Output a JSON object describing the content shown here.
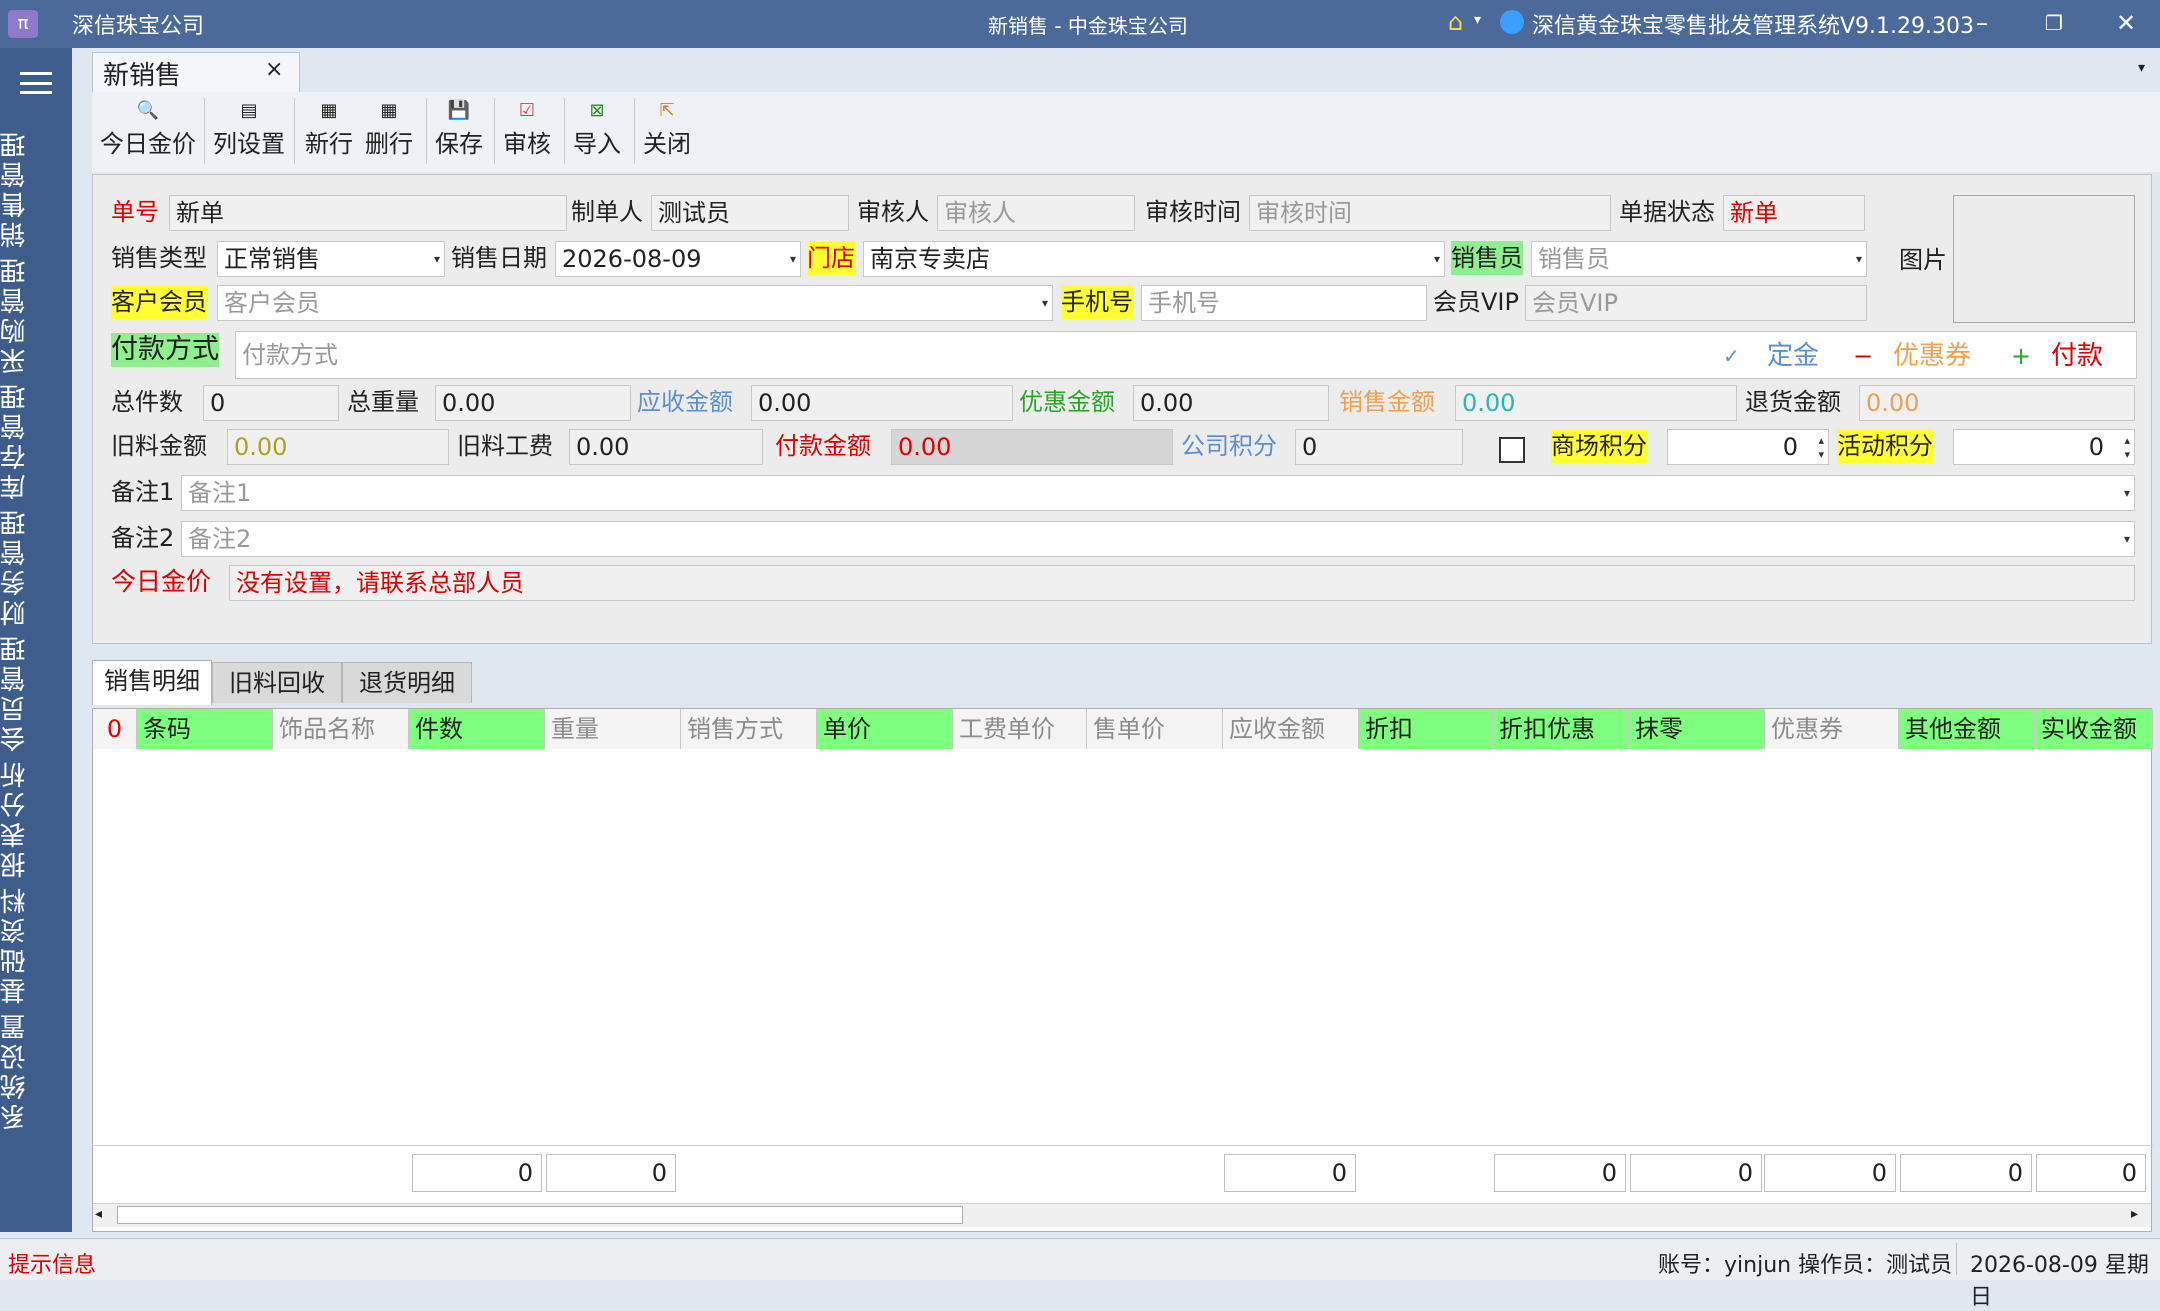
{
  "window": {
    "app_company": "深信珠宝公司",
    "doc_title": "新销售 - 中金珠宝公司",
    "system_title": "深信黄金珠宝零售批发管理系统V9.1.29.303"
  },
  "sidebar": {
    "items": [
      {
        "label": "销售管理"
      },
      {
        "label": "采购管理"
      },
      {
        "label": "库存管理"
      },
      {
        "label": "财务管理"
      },
      {
        "label": "会员管理"
      },
      {
        "label": "报表分析"
      },
      {
        "label": "基础资料"
      },
      {
        "label": "系统设置"
      }
    ]
  },
  "tabs": {
    "active": "新销售",
    "close": "×"
  },
  "toolbar": {
    "today_gold": "今日金价",
    "columns": "列设置",
    "new_row": "新行",
    "delete_row": "删行",
    "save": "保存",
    "audit": "审核",
    "import": "导入",
    "close": "关闭"
  },
  "form": {
    "doc_no_label": "单号",
    "doc_no": "新单",
    "maker_label": "制单人",
    "maker": "测试员",
    "auditor_label": "审核人",
    "auditor_ph": "审核人",
    "audit_time_label": "审核时间",
    "audit_time_ph": "审核时间",
    "status_label": "单据状态",
    "status": "新单",
    "image_label": "图片",
    "sale_type_label": "销售类型",
    "sale_type": "正常销售",
    "sale_date_label": "销售日期",
    "sale_date": "2026-08-09",
    "store_label": "门店",
    "store": "南京专卖店",
    "salesperson_label": "销售员",
    "salesperson_ph": "销售员",
    "customer_label": "客户会员",
    "customer_ph": "客户会员",
    "phone_label": "手机号",
    "phone_ph": "手机号",
    "vip_label": "会员VIP",
    "vip_ph": "会员VIP",
    "payment_label": "付款方式",
    "payment_ph": "付款方式",
    "deposit": "定金",
    "coupon": "优惠券",
    "pay": "付款",
    "total_pieces_label": "总件数",
    "total_pieces": "0",
    "total_weight_label": "总重量",
    "total_weight": "0.00",
    "receivable_label": "应收金额",
    "receivable": "0.00",
    "discount_label": "优惠金额",
    "discount": "0.00",
    "sales_amount_label": "销售金额",
    "sales_amount": "0.00",
    "return_amount_label": "退货金额",
    "return_amount": "0.00",
    "old_amount_label": "旧料金额",
    "old_amount": "0.00",
    "old_fee_label": "旧料工费",
    "old_fee": "0.00",
    "paid_label": "付款金额",
    "paid": "0.00",
    "company_points_label": "公司积分",
    "company_points": "0",
    "mall_points_label": "商场积分",
    "mall_points": "0",
    "event_points_label": "活动积分",
    "event_points": "0",
    "note1_label": "备注1",
    "note1_ph": "备注1",
    "note2_label": "备注2",
    "note2_ph": "备注2",
    "gold_price_label": "今日金价",
    "gold_price_msg": "没有设置，请联系总部人员"
  },
  "detail_tabs": [
    "销售明细",
    "旧料回收",
    "退货明细"
  ],
  "grid": {
    "row_count": "0",
    "columns": [
      "条码",
      "饰品名称",
      "件数",
      "重量",
      "销售方式",
      "单价",
      "工费单价",
      "售单价",
      "应收金额",
      "折扣",
      "折扣优惠",
      "抹零",
      "优惠券",
      "其他金额",
      "实收金额"
    ],
    "totals": [
      "0",
      "0",
      "0",
      "0",
      "0",
      "0",
      "0",
      "0"
    ]
  },
  "status": {
    "hint": "提示信息",
    "account": "账号：yinjun  操作员：测试员",
    "date": "2026-08-09 星期日"
  }
}
